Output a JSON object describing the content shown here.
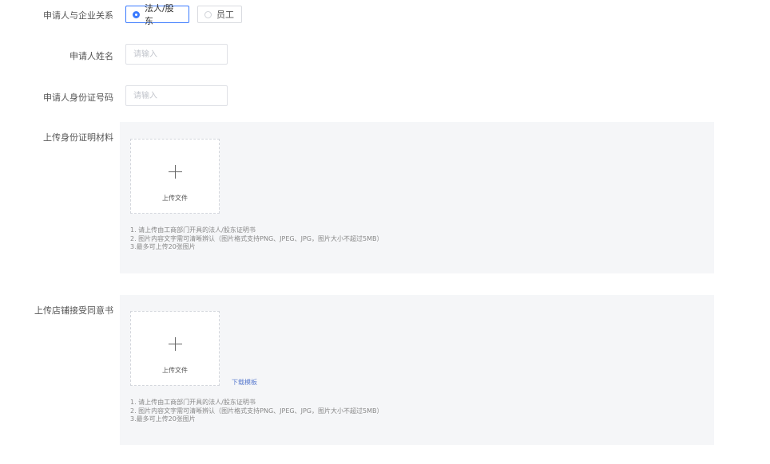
{
  "relation": {
    "label": "申请人与企业关系",
    "options": [
      "法人/股东",
      "员工"
    ],
    "selected": "法人/股东"
  },
  "name": {
    "label": "申请人姓名",
    "placeholder": "请输入"
  },
  "id_number": {
    "label": "申请人身份证号码",
    "placeholder": "请输入"
  },
  "id_upload": {
    "label": "上传身份证明材料",
    "button_text": "上传文件",
    "notes": [
      "1. 请上传由工商部门开具的法人/股东证明书",
      "2. 图片内容文字需可清晰辨认（图片格式支持PNG、JPEG、JPG，图片大小不超过5MB）",
      "3.最多可上传20张图片"
    ]
  },
  "consent_upload": {
    "label": "上传店铺接受同意书",
    "button_text": "上传文件",
    "download_link": "下载模板",
    "notes": [
      "1. 请上传由工商部门开具的法人/股东证明书",
      "2. 图片内容文字需可清晰辨认（图片格式支持PNG、JPEG、JPG，图片大小不超过5MB）",
      "3.最多可上传20张图片"
    ]
  },
  "colors": {
    "accent": "#3a7afe",
    "link": "#5b7ccf",
    "panel_bg": "#f5f6f8"
  }
}
